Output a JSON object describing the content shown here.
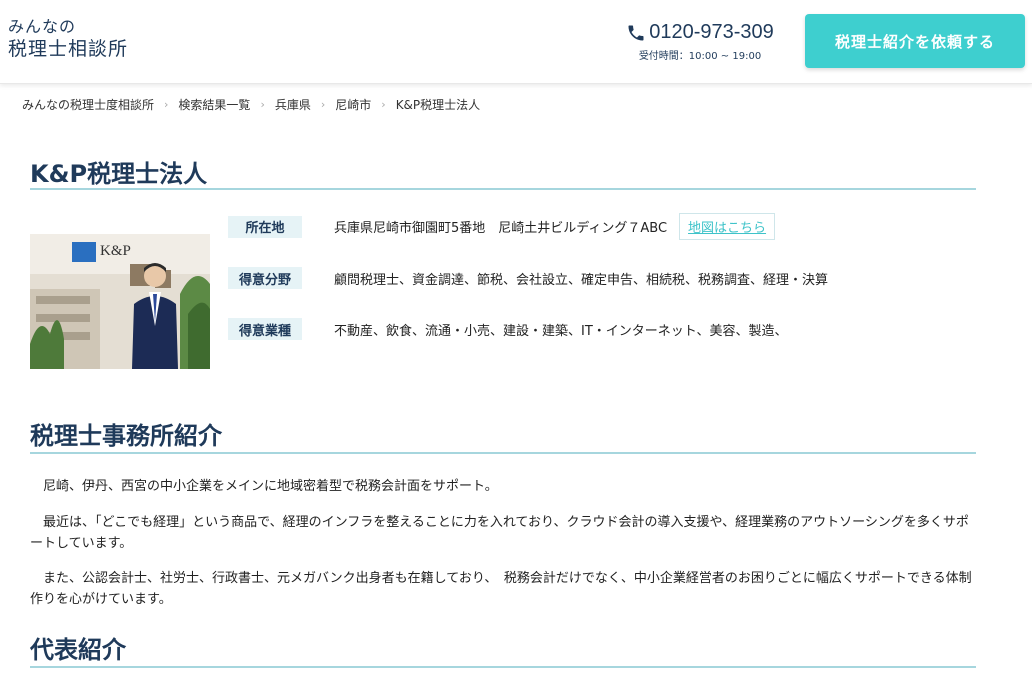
{
  "header": {
    "logo_line1": "みんなの",
    "logo_line2": "税理士相談所",
    "phone_number": "0120-973-309",
    "phone_hours": "受付時間：10:00 ~ 19:00",
    "cta_label": "税理士紹介を依頼する"
  },
  "breadcrumb": [
    "みんなの税理士度相談所",
    "検索結果一覧",
    "兵庫県",
    "尼崎市",
    "K&P税理士法人"
  ],
  "office": {
    "name": "K&P税理士法人",
    "photo_logo_text": "K&P",
    "location_label": "所在地",
    "location_value": "兵庫県尼崎市御園町5番地　尼崎土井ビルディング７ABC",
    "map_link": "地図はこちら",
    "specialty_label": "得意分野",
    "specialty_value": "顧問税理士、資金調達、節税、会社設立、確定申告、相続税、税務調査、経理・決算",
    "industry_label": "得意業種",
    "industry_value": "不動産、飲食、流通・小売、建設・建築、IT・インターネット、美容、製造、"
  },
  "intro": {
    "heading": "税理士事務所紹介",
    "p1": "尼崎、伊丹、西宮の中小企業をメインに地域密着型で税務会計面をサポート。",
    "p2": "最近は、「どこでも経理」という商品で、経理のインフラを整えることに力を入れており、クラウド会計の導入支援や、経理業務のアウトソーシングを多くサポートしています。",
    "p3": "また、公認会計士、社労士、行政書士、元メガバンク出身者も在籍しており、　税務会計だけでなく、中小企業経営者のお困りごとに幅広くサポートできる体制作りを心がけています。"
  },
  "representative": {
    "heading": "代表紹介"
  },
  "colors": {
    "accent": "#3ecfcf",
    "navy": "#1f3a5a",
    "label_bg": "#e6f3f6",
    "heading_rule": "#a6d6de"
  }
}
